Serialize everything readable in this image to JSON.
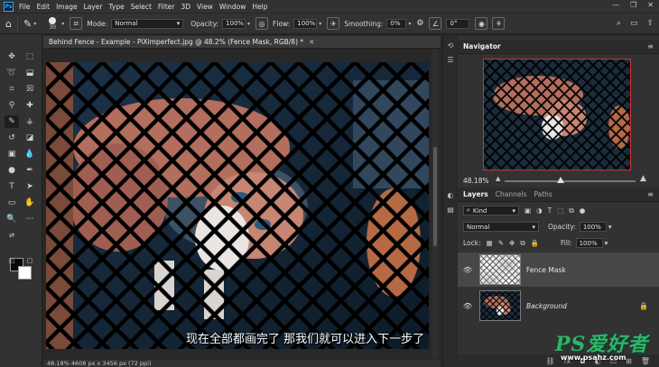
{
  "menubar": {
    "logo": "Ps",
    "items": [
      "File",
      "Edit",
      "Image",
      "Layer",
      "Type",
      "Select",
      "Filter",
      "3D",
      "View",
      "Window",
      "Help"
    ]
  },
  "options": {
    "brush_size": "30",
    "mode_label": "Mode:",
    "mode_value": "Normal",
    "opacity_label": "Opacity:",
    "opacity_value": "100%",
    "flow_label": "Flow:",
    "flow_value": "100%",
    "smoothing_label": "Smoothing:",
    "smoothing_value": "0%",
    "angle_value": "0°"
  },
  "document": {
    "tab_title": "Behind Fence - Example - PiXimperfect.jpg @ 48.2% (Fence Mask, RGB/8) *",
    "status": "48.18%   4608 px x 3456 px (72 ppi)"
  },
  "subtitle": "现在全部都画完了 那我们就可以进入下一步了",
  "navigator": {
    "title": "Navigator",
    "zoom": "48.18%"
  },
  "layers_panel": {
    "tabs": [
      "Layers",
      "Channels",
      "Paths"
    ],
    "kind_label": "Kind",
    "blend_mode": "Normal",
    "opacity_label": "Opacity:",
    "opacity_value": "100%",
    "lock_label": "Lock:",
    "fill_label": "Fill:",
    "fill_value": "100%",
    "layers": [
      {
        "name": "Fence Mask",
        "selected": true
      },
      {
        "name": "Background",
        "selected": false
      }
    ]
  },
  "watermark": {
    "logo": "PS爱好者",
    "url": "www.psahz.com"
  },
  "colors": {
    "accent": "#31a8ff",
    "panel_bg": "#323232",
    "app_bg": "#282828",
    "selected_layer": "#474747",
    "watermark_green": "#2fb36b"
  }
}
